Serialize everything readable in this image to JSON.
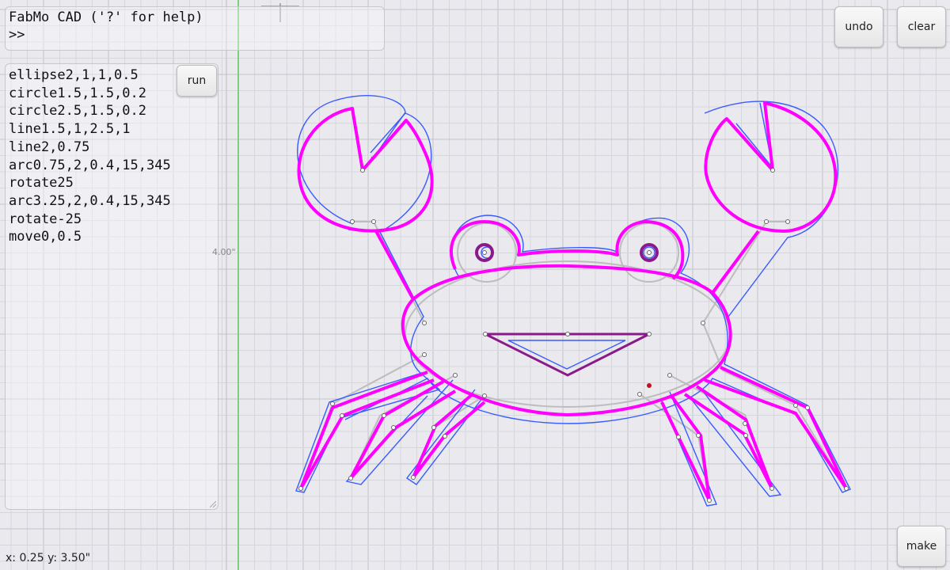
{
  "console": {
    "title": "FabMo CAD ('?' for help)",
    "prompt": ">>"
  },
  "editor": {
    "lines": [
      "ellipse2,1,1,0.5",
      "circle1.5,1.5,0.2",
      "circle2.5,1.5,0.2",
      "line1.5,1,2.5,1",
      "line2,0.75",
      "arc0.75,2,0.4,15,345",
      "rotate25",
      "arc3.25,2,0.4,15,345",
      "rotate-25",
      "move0,0.5"
    ]
  },
  "buttons": {
    "run": "run",
    "undo": "undo",
    "clear": "clear",
    "make": "make"
  },
  "status": {
    "coords": "x: 0.25 y: 3.50\""
  },
  "ruler": {
    "dimension_label": "4.00\""
  },
  "colors": {
    "background": "#e9e9ee",
    "grid_minor": "#d6d6dd",
    "grid_major": "#c4c4cc",
    "axis_green": "#7ccf7c",
    "toolpath_magenta": "#ff00ff",
    "offset_blue": "#3a5bff",
    "construction_gray": "#b5b5b5",
    "mouth_purple": "#8a1a8a"
  }
}
